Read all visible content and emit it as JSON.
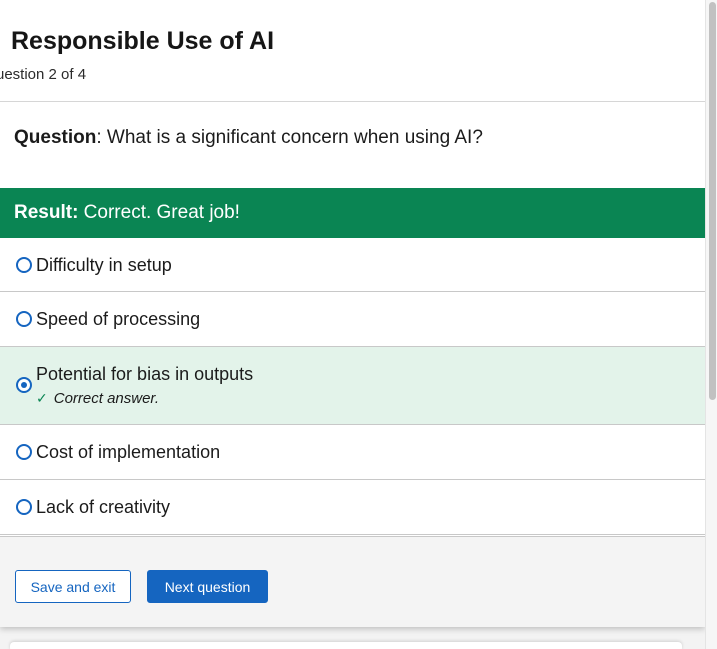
{
  "quiz": {
    "title": "Responsible Use of AI",
    "progress": "uestion 2 of 4"
  },
  "question": {
    "prefix": "Question",
    "text": ": What is a significant concern when using AI?"
  },
  "result": {
    "prefix": "Result:",
    "text": " Correct. Great job!",
    "color": "#0a8553"
  },
  "options": [
    {
      "label": "Difficulty in setup",
      "selected": false
    },
    {
      "label": "Speed of processing",
      "selected": false
    },
    {
      "label": "Potential for bias in outputs",
      "selected": true,
      "feedback": "Correct answer."
    },
    {
      "label": "Cost of implementation",
      "selected": false
    },
    {
      "label": "Lack of creativity",
      "selected": false
    }
  ],
  "buttons": {
    "save_exit": "Save and exit",
    "next": "Next question"
  },
  "colors": {
    "accent": "#1565c0",
    "success": "#0a8553",
    "selected_bg": "#e3f3ea"
  }
}
